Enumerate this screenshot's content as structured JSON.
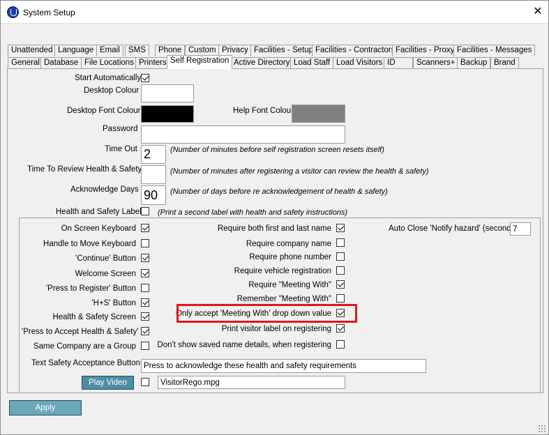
{
  "window": {
    "title": "System Setup",
    "close_glyph": "✕",
    "icon": "app-shield-icon"
  },
  "tabs_row1": [
    "Unattended",
    "Language",
    "Email",
    "SMS",
    "Phone",
    "Custom",
    "Privacy",
    "Facilities - Setup",
    "Facilities - Contractors",
    "Facilities - Proxy",
    "Facilities - Messages"
  ],
  "tabs_row2": [
    "General",
    "Database",
    "File Locations",
    "Printers",
    "Self Registration",
    "Active Directory",
    "Load Staff",
    "Load Visitors",
    "ID",
    "Scanners+",
    "Backup",
    "Brand"
  ],
  "active_tab": "Self Registration",
  "form": {
    "start_automatically": {
      "label": "Start Automatically",
      "checked": true
    },
    "desktop_colour": {
      "label": "Desktop Colour",
      "color": "#ffffff"
    },
    "desktop_font_colour": {
      "label": "Desktop Font Colour",
      "color": "#000000"
    },
    "help_font_colour": {
      "label": "Help Font Colour",
      "color": "#808080"
    },
    "password": {
      "label": "Password",
      "value": ""
    },
    "time_out": {
      "label": "Time Out",
      "value": "2",
      "note": "(Number of minutes before self registration screen resets itself)"
    },
    "time_review": {
      "label": "Time To Review Health & Safety",
      "value": "",
      "note": "(Number of minutes after registering a visitor can review the  health & safety)"
    },
    "acknowledge_days": {
      "label": "Acknowledge Days",
      "value": "90",
      "note": "(Number of days before re acknowledgement of health & safety)"
    },
    "health_safety_label": {
      "label": "Health and Safety Label",
      "checked": false,
      "note": "(Print a second label with health and safety instructions)"
    }
  },
  "group_left": [
    {
      "label": "On Screen Keyboard",
      "checked": true
    },
    {
      "label": "Handle to Move Keyboard",
      "checked": false
    },
    {
      "label": "'Continue' Button",
      "checked": true
    },
    {
      "label": "Welcome Screen",
      "checked": true
    },
    {
      "label": "'Press to Register' Button",
      "checked": false
    },
    {
      "label": "'H+S' Button",
      "checked": true
    },
    {
      "label": "Health & Safety Screen",
      "checked": true
    },
    {
      "label": "'Press to Accept Health & Safety'",
      "checked": true
    },
    {
      "label": "Same Company are a Group",
      "checked": false
    }
  ],
  "group_mid": [
    {
      "label": "Require both first and last name",
      "checked": true
    },
    {
      "label": "Require company name",
      "checked": false
    },
    {
      "label": "Require phone number",
      "checked": false
    },
    {
      "label": "Require vehicle registration",
      "checked": false
    },
    {
      "label": "Require \"Meeting With\"",
      "checked": true
    },
    {
      "label": "Remember \"Meeting With\"",
      "checked": false
    },
    {
      "label": "Only accept 'Meeting With' drop down value",
      "checked": true
    },
    {
      "label": "Print visitor label on registering",
      "checked": true
    },
    {
      "label": "Don't show saved name details, when registering",
      "checked": false
    }
  ],
  "auto_close": {
    "label": "Auto Close 'Notify hazard' (seconds)",
    "value": "7"
  },
  "text_safety": {
    "label": "Text Safety Acceptance Button",
    "value": "Press to acknowledge these health and safety requirements"
  },
  "video": {
    "button": "Play Video",
    "checked": false,
    "file": "VisitorRego.mpg"
  },
  "apply_button": "Apply",
  "colors": {
    "accent_button": "#4e8ea3",
    "apply_button": "#6aa7b9",
    "highlight": "#e0181b"
  }
}
